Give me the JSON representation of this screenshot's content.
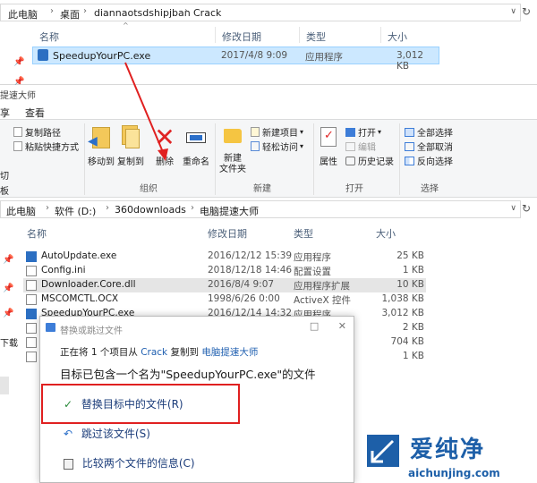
{
  "top_window": {
    "breadcrumb": [
      "此电脑",
      "桌面",
      "diannaotsdshipjban",
      "Crack"
    ],
    "columns": [
      "名称",
      "修改日期",
      "类型",
      "大小"
    ],
    "file": {
      "name": "SpeedupYourPC.exe",
      "date": "2017/4/8 9:09",
      "type": "应用程序",
      "size": "3,012 KB"
    }
  },
  "second_window": {
    "title": "提速大师",
    "tabs": [
      "享",
      "查看"
    ],
    "ribbon": {
      "clipboard_left": [
        "切",
        "板"
      ],
      "copy_path": "复制路径",
      "paste_shortcut": "粘贴快捷方式",
      "move_to": "移动到",
      "copy_to": "复制到",
      "delete": "删除",
      "rename": "重命名",
      "organize": "组织",
      "new_folder_line1": "新建",
      "new_folder_line2": "文件夹",
      "new_item": "新建项目",
      "easy_access": "轻松访问",
      "new_group": "新建",
      "properties": "属性",
      "open": "打开",
      "edit": "编辑",
      "history": "历史记录",
      "open_group": "打开",
      "select_all": "全部选择",
      "select_none": "全部取消",
      "invert_selection": "反向选择",
      "select_group": "选择"
    },
    "breadcrumb": [
      "此电脑",
      "软件 (D:)",
      "360downloads",
      "电脑提速大师"
    ],
    "columns": [
      "名称",
      "修改日期",
      "类型",
      "大小"
    ],
    "files": [
      {
        "name": "AutoUpdate.exe",
        "date": "2016/12/12 15:39",
        "type": "应用程序",
        "size": "25 KB"
      },
      {
        "name": "Config.ini",
        "date": "2018/12/18 14:46",
        "type": "配置设置",
        "size": "1 KB"
      },
      {
        "name": "Downloader.Core.dll",
        "date": "2016/8/4 9:07",
        "type": "应用程序扩展",
        "size": "10 KB"
      },
      {
        "name": "MSCOMCTL.OCX",
        "date": "1998/6/26 0:00",
        "type": "ActiveX 控件",
        "size": "1,038 KB"
      },
      {
        "name": "SpeedupYourPC.exe",
        "date": "2016/12/14 14:32",
        "type": "应用程序",
        "size": "3,012 KB"
      },
      {
        "name": "",
        "date": "",
        "type": "",
        "size": "2 KB"
      },
      {
        "name": "",
        "date": "",
        "type": "",
        "size": "704 KB"
      },
      {
        "name": "",
        "date": "",
        "type": "",
        "size": "1 KB"
      }
    ],
    "left_nav_fragment": "下载"
  },
  "dialog": {
    "title": "替换或跳过文件",
    "line1_prefix": "正在将 1 个项目从",
    "source": "Crack",
    "line1_mid": "复制到",
    "destination": "电脑提速大师",
    "message": "目标已包含一个名为\"SpeedupYourPC.exe\"的文件",
    "option_replace": "替换目标中的文件(R)",
    "option_skip": "跳过该文件(S)",
    "option_compare": "比较两个文件的信息(C)"
  },
  "watermark": {
    "brand": "爱纯净",
    "url": "aichunjing.com"
  },
  "colors": {
    "selection": "#cce8ff",
    "highlight_box": "#e02020",
    "arrow": "#e02020",
    "link": "#1f5fb0"
  }
}
